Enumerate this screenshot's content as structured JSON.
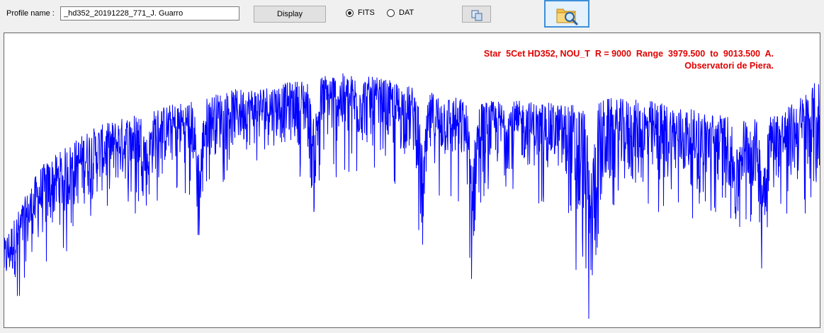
{
  "toolbar": {
    "profile_label": "Profile name :",
    "profile_value": "_hd352_20191228_771_J. Guarro",
    "display_label": "Display",
    "radio_options": [
      {
        "label": "FITS",
        "checked": true
      },
      {
        "label": "DAT",
        "checked": false
      }
    ],
    "copy_icon": "copy-icon",
    "open_icon": "folder-search-icon"
  },
  "plot": {
    "title_line1": "Star  5Cet HD352, NOU_T  R = 9000  Range  3979.500  to  9013.500  A.",
    "title_line2": "Observatori de Piera.",
    "title_color": "#e00000",
    "line_color": "#0000ff",
    "background": "#ffffff"
  },
  "chart_data": {
    "type": "line",
    "title": "Star  5Cet HD352, NOU_T  R = 9000  Range  3979.500  to  9013.500  A.",
    "subtitle": "Observatori de Piera.",
    "xlabel": "",
    "ylabel": "",
    "xlim": [
      3979.5,
      9013.5
    ],
    "grid": false,
    "legend": "none",
    "envelope_x": [
      3979.5,
      4200,
      4500,
      4800,
      5100,
      5400,
      5700,
      6000,
      6300,
      6560,
      6700,
      6900,
      7200,
      7400,
      7600,
      7700,
      8000,
      8300,
      8600,
      8800,
      9013.5
    ],
    "envelope_upper": [
      0.3,
      0.55,
      0.68,
      0.74,
      0.78,
      0.82,
      0.84,
      0.88,
      0.86,
      0.82,
      0.8,
      0.78,
      0.78,
      0.77,
      0.78,
      0.79,
      0.78,
      0.74,
      0.72,
      0.75,
      0.86
    ],
    "envelope_lower": [
      0.1,
      0.28,
      0.42,
      0.5,
      0.56,
      0.6,
      0.62,
      0.62,
      0.6,
      0.56,
      0.55,
      0.52,
      0.54,
      0.52,
      0.05,
      0.45,
      0.46,
      0.48,
      0.44,
      0.5,
      0.4
    ],
    "absorption_features": [
      {
        "x": 4861,
        "depth": 0.38
      },
      {
        "x": 5183,
        "depth": 0.22
      },
      {
        "x": 5890,
        "depth": 0.35
      },
      {
        "x": 6563,
        "depth": 0.18
      },
      {
        "x": 6870,
        "depth": 0.2
      },
      {
        "x": 7600,
        "depth": 0.05
      },
      {
        "x": 8498,
        "depth": 0.28
      },
      {
        "x": 8662,
        "depth": 0.24
      }
    ]
  }
}
